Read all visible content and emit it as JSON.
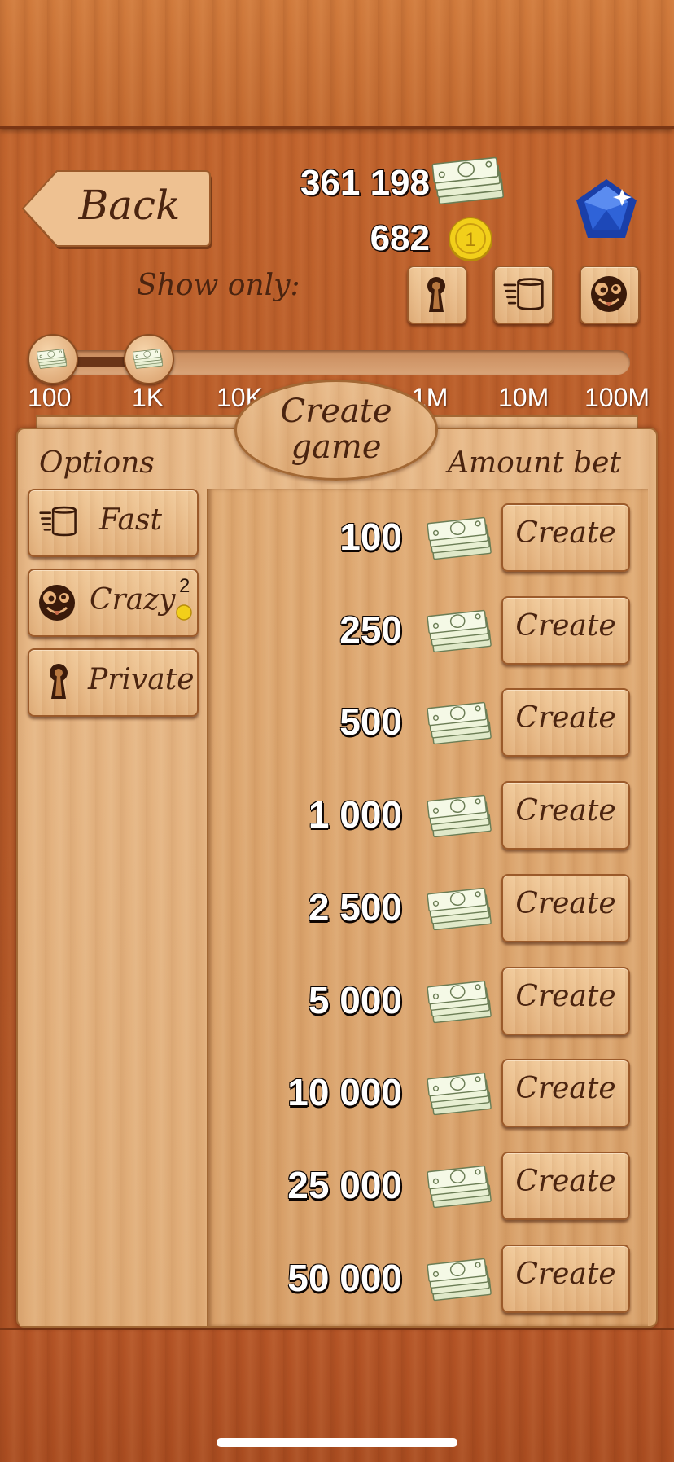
{
  "header": {
    "back_label": "Back",
    "money_balance": "361 198",
    "coin_balance": "682",
    "show_only_label": "Show only:"
  },
  "filters": [
    {
      "name": "private-filter",
      "icon": "keyhole-icon"
    },
    {
      "name": "fast-filter",
      "icon": "fast-barrel-icon"
    },
    {
      "name": "crazy-filter",
      "icon": "crazy-face-icon"
    }
  ],
  "slider": {
    "ticks": [
      "100",
      "1K",
      "10K",
      "1M",
      "10M",
      "100M"
    ],
    "selected_min": "100",
    "selected_max": "1K"
  },
  "panel": {
    "title_line1": "Create",
    "title_line2": "game",
    "options_header": "Options",
    "amount_header": "Amount bet"
  },
  "options": [
    {
      "label": "Fast",
      "icon": "fast-barrel-icon"
    },
    {
      "label": "Crazy",
      "icon": "crazy-face-icon",
      "cost": "2"
    },
    {
      "label": "Private",
      "icon": "keyhole-icon"
    }
  ],
  "bets": [
    {
      "amount": "100",
      "button": "Create"
    },
    {
      "amount": "250",
      "button": "Create"
    },
    {
      "amount": "500",
      "button": "Create"
    },
    {
      "amount": "1 000",
      "button": "Create"
    },
    {
      "amount": "2 500",
      "button": "Create"
    },
    {
      "amount": "5 000",
      "button": "Create"
    },
    {
      "amount": "10 000",
      "button": "Create"
    },
    {
      "amount": "25 000",
      "button": "Create"
    },
    {
      "amount": "50 000",
      "button": "Create"
    }
  ],
  "colors": {
    "text_brown": "#4a2410",
    "coin_gold": "#f2cf1a",
    "gem_blue": "#1f4fc8"
  }
}
